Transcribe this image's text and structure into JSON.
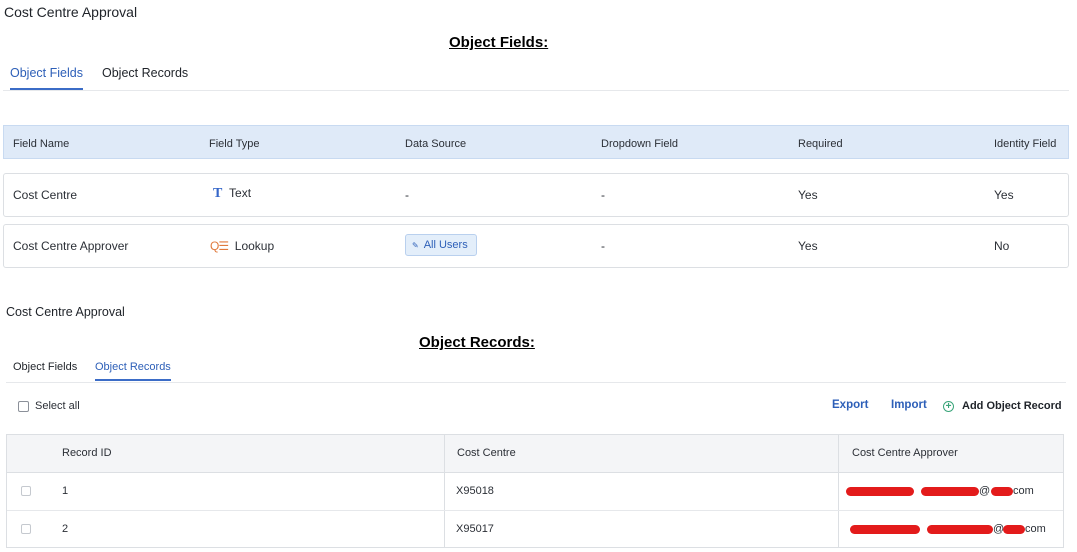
{
  "top": {
    "app_title": "Cost Centre Approval",
    "heading": "Object Fields:",
    "tabs": [
      {
        "label": "Object Fields",
        "active": true
      },
      {
        "label": "Object Records",
        "active": false
      }
    ],
    "columns": [
      "Field Name",
      "Field Type",
      "Data Source",
      "Dropdown Field",
      "Required",
      "Identity Field"
    ],
    "rows": [
      {
        "field_name": "Cost Centre",
        "field_type_icon": "text-icon",
        "field_type_glyph": "T",
        "field_type": "Text",
        "data_source": "-",
        "dropdown_field": "-",
        "required": "Yes",
        "identity_field": "Yes"
      },
      {
        "field_name": "Cost Centre Approver",
        "field_type_icon": "lookup-icon",
        "field_type_glyph": "Q☰",
        "field_type": "Lookup",
        "data_source_chip": "All Users",
        "dropdown_field": "-",
        "required": "Yes",
        "identity_field": "No"
      }
    ]
  },
  "bottom": {
    "app_title": "Cost Centre Approval",
    "heading": "Object Records:",
    "tabs": [
      {
        "label": "Object Fields",
        "active": false
      },
      {
        "label": "Object Records",
        "active": true
      }
    ],
    "select_all": "Select all",
    "export": "Export",
    "import": "Import",
    "add_record": "Add Object Record",
    "columns": [
      "Record ID",
      "Cost Centre",
      "Cost Centre Approver"
    ],
    "rows": [
      {
        "record_id": "1",
        "cost_centre": "X95018",
        "approver_visible": "@",
        "approver_suffix": "com"
      },
      {
        "record_id": "2",
        "cost_centre": "X95017",
        "approver_visible": "@",
        "approver_suffix": "com"
      }
    ]
  },
  "colors": {
    "accent": "#2d5fb8",
    "header_bg": "#dfeaf8",
    "redaction": "#e31b1b",
    "lookup_icon": "#e07a3c",
    "add_icon": "#3aa57a"
  }
}
